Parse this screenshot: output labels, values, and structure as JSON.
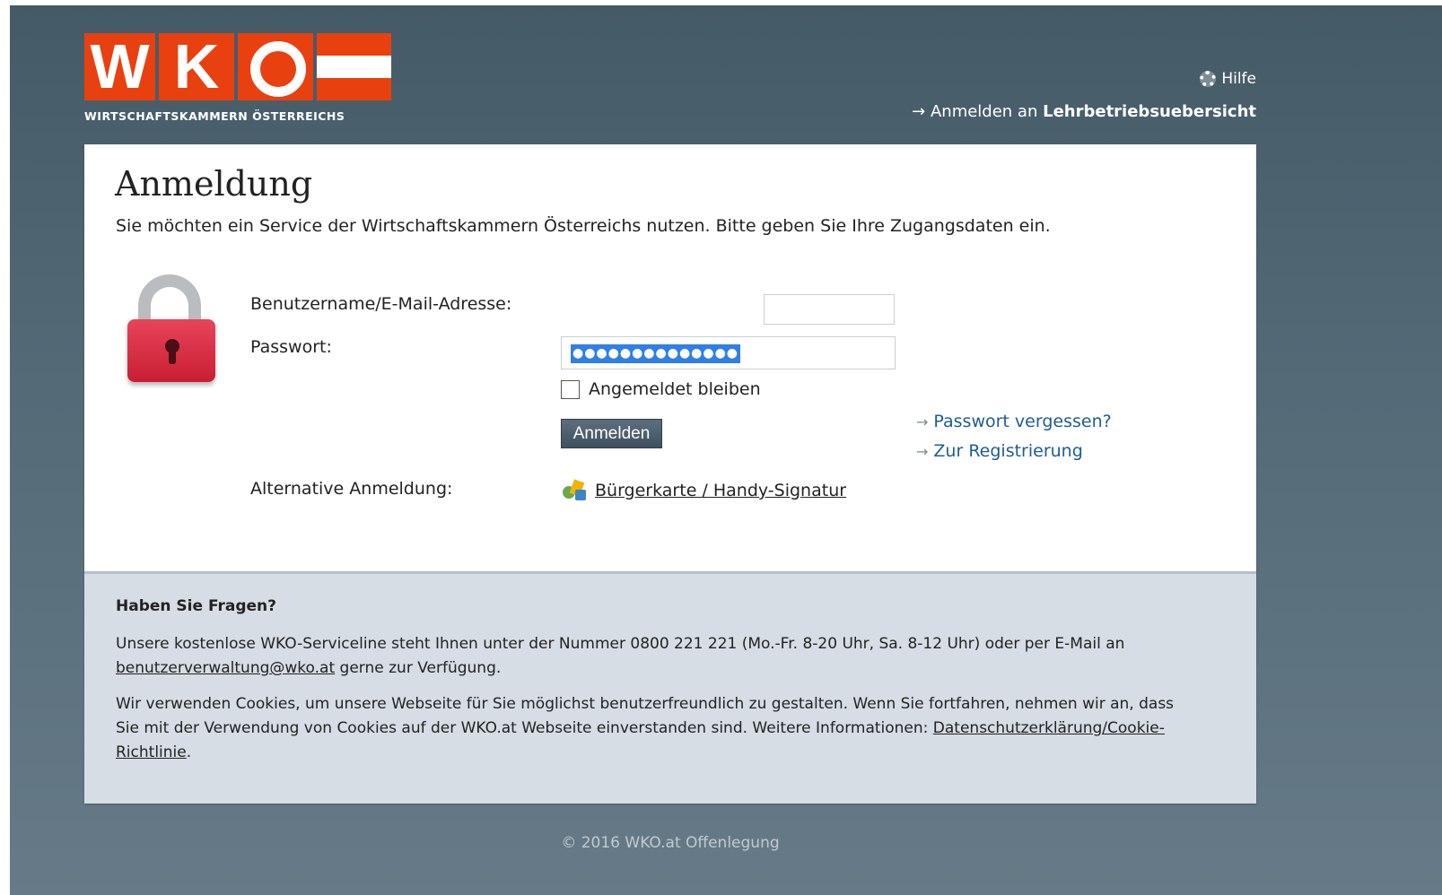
{
  "logo": {
    "letters": [
      "W",
      "K",
      "O"
    ],
    "subtitle": "WIRTSCHAFTSKAMMERN ÖSTERREICHS",
    "color": "#e8410f"
  },
  "header": {
    "help_label": "Hilfe",
    "help_icon": "lifebuoy-icon",
    "signin_prefix": "→ Anmelden an ",
    "signin_target": "Lehrbetriebsuebersicht"
  },
  "login": {
    "title": "Anmeldung",
    "intro": "Sie möchten ein Service der Wirtschaftskammern Österreichs nutzen. Bitte geben Sie Ihre Zugangsdaten ein.",
    "username_label": "Benutzername/E-Mail-Adresse:",
    "username_value": "",
    "password_label": "Passwort:",
    "password_mask": "●●●●●●●●●●●●●●",
    "remember_label": "Angemeldet bleiben",
    "remember_checked": false,
    "submit_label": "Anmelden",
    "forgot_label": "Passwort vergessen?",
    "register_label": "Zur Registrierung",
    "alt_label": "Alternative Anmeldung:",
    "alt_link": "Bürgerkarte / Handy-Signatur",
    "link_color": "#1c5c95"
  },
  "info": {
    "heading": "Haben Sie Fragen?",
    "p1_text": "Unsere kostenlose WKO-Serviceline steht Ihnen unter der Nummer 0800 221 221 (Mo.-Fr. 8-20 Uhr, Sa. 8-12 Uhr) oder per E-Mail an ",
    "p1_email": "benutzerverwaltung@wko.at",
    "p1_after": " gerne zur Verfügung.",
    "p2_text": "Wir verwenden Cookies, um unsere Webseite für Sie möglichst benutzerfreundlich zu gestalten. Wenn Sie fortfahren, nehmen wir an, dass Sie mit der Verwendung von Cookies auf der WKO.at Webseite einverstanden sind. Weitere Informationen: ",
    "p2_link": "Datenschutzerklärung/Cookie-Richtlinie",
    "p2_after": "."
  },
  "footer": {
    "text": "© 2016 WKO.at Offenlegung"
  }
}
